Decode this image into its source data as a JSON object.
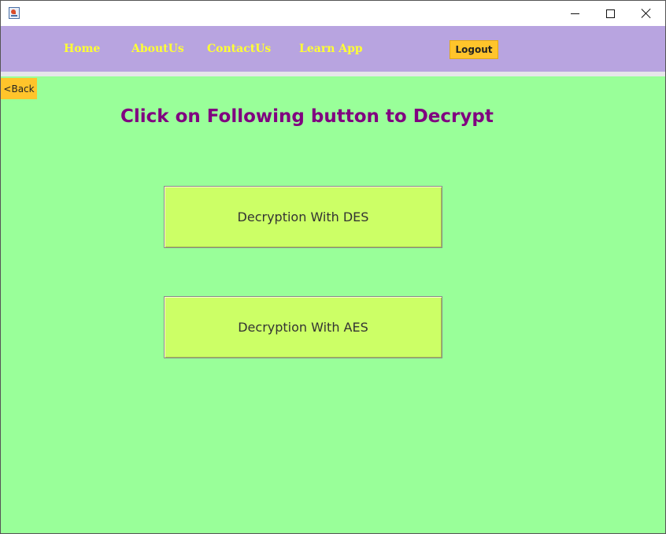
{
  "window": {
    "icon": "java-app-icon",
    "controls": [
      "minimize-icon",
      "maximize-icon",
      "close-icon"
    ]
  },
  "navbar": {
    "items": [
      {
        "label": "Home"
      },
      {
        "label": "AboutUs"
      },
      {
        "label": "ContactUs"
      },
      {
        "label": "Learn App"
      }
    ],
    "logout_label": "Logout"
  },
  "main": {
    "back_label": "<Back",
    "heading": "Click on Following button to Decrypt",
    "buttons": [
      {
        "label": "Decryption With DES"
      },
      {
        "label": "Decryption With AES"
      }
    ]
  },
  "colors": {
    "navbar_bg": "#b8a4e0",
    "nav_link": "#ffff33",
    "content_bg": "#99ff99",
    "heading": "#800080",
    "button_bg": "#ccff66",
    "accent_button": "#ffc42b"
  }
}
